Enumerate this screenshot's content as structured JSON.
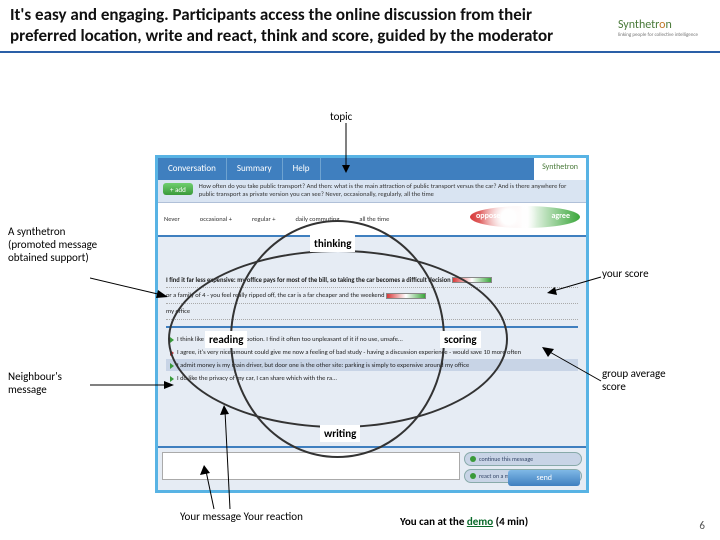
{
  "header": {
    "headline": "It's easy and engaging. Participants access the online discussion from their preferred location, write and react, think and score, guided by the moderator",
    "logo_text": "Synthetron",
    "logo_tagline": "linking people for collective intelligence"
  },
  "callouts": {
    "topic": "topic",
    "synthetron": "A synthetron (promoted message obtained support)",
    "neighbour": "Neighbour's message",
    "your_score": "your score",
    "group_score": "group average score",
    "your_message": "Your message Your reaction",
    "demo_prefix": "You can at the ",
    "demo_link": "demo",
    "demo_suffix": " (4 min)"
  },
  "ellipse_labels": {
    "thinking": "thinking",
    "reading": "reading",
    "scoring": "scoring",
    "writing": "writing"
  },
  "app": {
    "tabs": [
      "Conversation",
      "Summary",
      "Help"
    ],
    "logo": "Synthetron",
    "add_btn": "+ add",
    "topic_text": "How often do you take public transport? And then: what is the main attraction of public transport versus the car? And is there anywhere for public transport as private version you can see? Never, occasionally, regularly, all the time",
    "scale": [
      "Never",
      "occasional +",
      "regular +",
      "daily commuting",
      "all the time"
    ],
    "oppose": "oppose",
    "agree": "agree",
    "messages": {
      "bold": "I find it far less expensive: my office pays for most of the bill, so taking the car becomes a difficult decision",
      "m2": "or a family of 4 - you feel really ripped off, the car is a far cheaper and the weekend",
      "m3": "my office"
    },
    "reactions": {
      "r1": "I think like in the road is a potion. I find it often too unpleasant of it if no use, unsafe...",
      "r2": "I agree, it's very nice amount could give me now a feeling of bad study - having a discussion experience - would save 10 more often",
      "r3": "I admit money is my main driver, but door one is the other site: parking is simply to expensive around my office",
      "r4": "I do like the privacy of my car, I can share which with the ra..."
    },
    "side_pills": {
      "p1": "continue this message",
      "p2": "react on a message"
    },
    "send": "send"
  },
  "page_number": "6"
}
